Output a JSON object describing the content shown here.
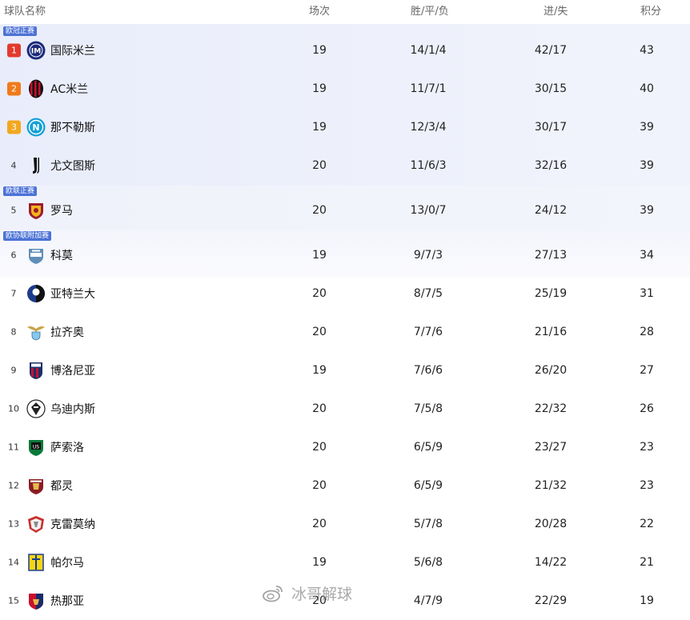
{
  "header": {
    "team": "球队名称",
    "played": "场次",
    "wdl": "胜/平/负",
    "goals": "进/失",
    "points": "积分"
  },
  "zones": {
    "ucl": "欧冠正赛",
    "uel": "欧联正赛",
    "uecl": "欧协联附加赛"
  },
  "colors": {
    "rank1": "#e33a2e",
    "rank2": "#f07a1a",
    "rank3": "#f2a71f",
    "zone_badge": "#4b72d6",
    "ucl_bg": "#e9edfb"
  },
  "rows": [
    {
      "rank": "1",
      "team": "国际米兰",
      "played": "19",
      "wdl": "14/1/4",
      "goals": "42/17",
      "points": "43",
      "icon": "inter-logo-icon"
    },
    {
      "rank": "2",
      "team": "AC米兰",
      "played": "19",
      "wdl": "11/7/1",
      "goals": "30/15",
      "points": "40",
      "icon": "ac-milan-logo-icon"
    },
    {
      "rank": "3",
      "team": "那不勒斯",
      "played": "19",
      "wdl": "12/3/4",
      "goals": "30/17",
      "points": "39",
      "icon": "napoli-logo-icon"
    },
    {
      "rank": "4",
      "team": "尤文图斯",
      "played": "20",
      "wdl": "11/6/3",
      "goals": "32/16",
      "points": "39",
      "icon": "juventus-logo-icon"
    },
    {
      "rank": "5",
      "team": "罗马",
      "played": "20",
      "wdl": "13/0/7",
      "goals": "24/12",
      "points": "39",
      "icon": "roma-logo-icon"
    },
    {
      "rank": "6",
      "team": "科莫",
      "played": "19",
      "wdl": "9/7/3",
      "goals": "27/13",
      "points": "34",
      "icon": "como-logo-icon"
    },
    {
      "rank": "7",
      "team": "亚特兰大",
      "played": "20",
      "wdl": "8/7/5",
      "goals": "25/19",
      "points": "31",
      "icon": "atalanta-logo-icon"
    },
    {
      "rank": "8",
      "team": "拉齐奥",
      "played": "20",
      "wdl": "7/7/6",
      "goals": "21/16",
      "points": "28",
      "icon": "lazio-logo-icon"
    },
    {
      "rank": "9",
      "team": "博洛尼亚",
      "played": "19",
      "wdl": "7/6/6",
      "goals": "26/20",
      "points": "27",
      "icon": "bologna-logo-icon"
    },
    {
      "rank": "10",
      "team": "乌迪内斯",
      "played": "20",
      "wdl": "7/5/8",
      "goals": "22/32",
      "points": "26",
      "icon": "udinese-logo-icon"
    },
    {
      "rank": "11",
      "team": "萨索洛",
      "played": "20",
      "wdl": "6/5/9",
      "goals": "23/27",
      "points": "23",
      "icon": "sassuolo-logo-icon"
    },
    {
      "rank": "12",
      "team": "都灵",
      "played": "20",
      "wdl": "6/5/9",
      "goals": "21/32",
      "points": "23",
      "icon": "torino-logo-icon"
    },
    {
      "rank": "13",
      "team": "克雷莫纳",
      "played": "20",
      "wdl": "5/7/8",
      "goals": "20/28",
      "points": "22",
      "icon": "cremonese-logo-icon"
    },
    {
      "rank": "14",
      "team": "帕尔马",
      "played": "19",
      "wdl": "5/6/8",
      "goals": "14/22",
      "points": "21",
      "icon": "parma-logo-icon"
    },
    {
      "rank": "15",
      "team": "热那亚",
      "played": "20",
      "wdl": "4/7/9",
      "goals": "22/29",
      "points": "19",
      "icon": "genoa-logo-icon"
    }
  ],
  "watermark": {
    "text": "冰哥解球",
    "icon": "weibo-logo-icon"
  }
}
